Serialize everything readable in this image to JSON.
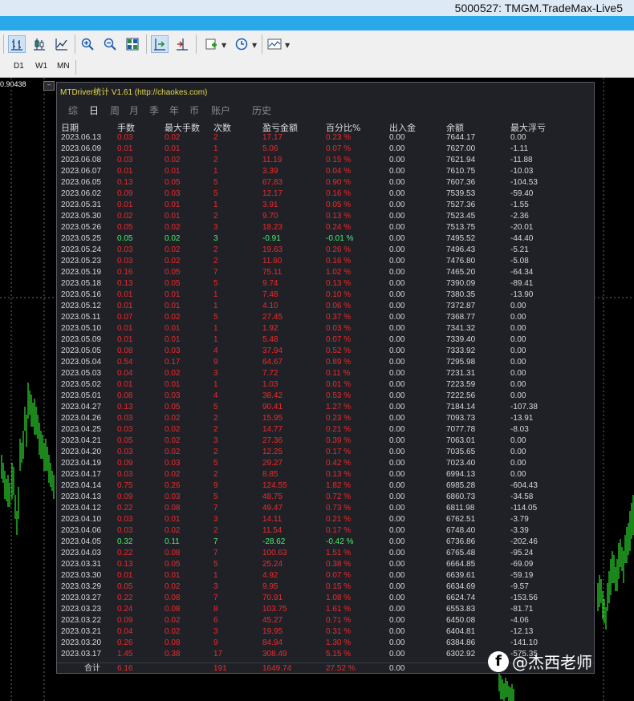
{
  "window": {
    "title": "5000527: TMGM.TradeMax-Live5"
  },
  "toolbar": {
    "icons": [
      "bar-chart-icon",
      "candlestick-icon",
      "line-chart-icon",
      "zoom-in-icon",
      "zoom-out-icon",
      "tile-windows-icon",
      "chart-shift-icon",
      "autoscroll-icon",
      "indicators-icon",
      "periods-icon",
      "templates-icon"
    ]
  },
  "timeframes": [
    "D1",
    "W1",
    "MN"
  ],
  "chart": {
    "price_label": "0.90438"
  },
  "panel": {
    "title": "MTDriver统计 V1.61  (http://chaokes.com)",
    "minimize_label": "–",
    "tabs": [
      "综",
      "日",
      "周",
      "月",
      "季",
      "年",
      "币",
      "账户",
      "历史"
    ],
    "active_tab": "日",
    "headers": [
      "日期",
      "手数",
      "最大手数",
      "次数",
      "盈亏金额",
      "百分比%",
      "出入金",
      "余额",
      "最大浮亏"
    ],
    "rows": [
      [
        "2023.06.13",
        "0.03",
        "0.02",
        "2",
        "17.17",
        "0.23 %",
        "0.00",
        "7644.17",
        "0.00"
      ],
      [
        "2023.06.09",
        "0.01",
        "0.01",
        "1",
        "5.06",
        "0.07 %",
        "0.00",
        "7627.00",
        "-1.11"
      ],
      [
        "2023.06.08",
        "0.03",
        "0.02",
        "2",
        "11.19",
        "0.15 %",
        "0.00",
        "7621.94",
        "-11.88"
      ],
      [
        "2023.06.07",
        "0.01",
        "0.01",
        "1",
        "3.39",
        "0.04 %",
        "0.00",
        "7610.75",
        "-10.03"
      ],
      [
        "2023.06.05",
        "0.13",
        "0.05",
        "5",
        "67.83",
        "0.90 %",
        "0.00",
        "7607.36",
        "-104.53"
      ],
      [
        "2023.06.02",
        "0.09",
        "0.03",
        "5",
        "12.17",
        "0.16 %",
        "0.00",
        "7539.53",
        "-59.40"
      ],
      [
        "2023.05.31",
        "0.01",
        "0.01",
        "1",
        "3.91",
        "0.05 %",
        "0.00",
        "7527.36",
        "-1.55"
      ],
      [
        "2023.05.30",
        "0.02",
        "0.01",
        "2",
        "9.70",
        "0.13 %",
        "0.00",
        "7523.45",
        "-2.36"
      ],
      [
        "2023.05.26",
        "0.05",
        "0.02",
        "3",
        "18.23",
        "0.24 %",
        "0.00",
        "7513.75",
        "-20.01"
      ],
      [
        "2023.05.25",
        "0.05",
        "0.02",
        "3",
        "-0.91",
        "-0.01 %",
        "0.00",
        "7495.52",
        "-44.40"
      ],
      [
        "2023.05.24",
        "0.03",
        "0.02",
        "2",
        "19.63",
        "0.26 %",
        "0.00",
        "7496.43",
        "-5.21"
      ],
      [
        "2023.05.23",
        "0.03",
        "0.02",
        "2",
        "11.60",
        "0.16 %",
        "0.00",
        "7476.80",
        "-5.08"
      ],
      [
        "2023.05.19",
        "0.16",
        "0.05",
        "7",
        "75.11",
        "1.02 %",
        "0.00",
        "7465.20",
        "-64.34"
      ],
      [
        "2023.05.18",
        "0.13",
        "0.05",
        "5",
        "9.74",
        "0.13 %",
        "0.00",
        "7390.09",
        "-89.41"
      ],
      [
        "2023.05.16",
        "0.01",
        "0.01",
        "1",
        "7.48",
        "0.10 %",
        "0.00",
        "7380.35",
        "-13.90"
      ],
      [
        "2023.05.12",
        "0.01",
        "0.01",
        "1",
        "4.10",
        "0.06 %",
        "0.00",
        "7372.87",
        "0.00"
      ],
      [
        "2023.05.11",
        "0.07",
        "0.02",
        "5",
        "27.45",
        "0.37 %",
        "0.00",
        "7368.77",
        "0.00"
      ],
      [
        "2023.05.10",
        "0.01",
        "0.01",
        "1",
        "1.92",
        "0.03 %",
        "0.00",
        "7341.32",
        "0.00"
      ],
      [
        "2023.05.09",
        "0.01",
        "0.01",
        "1",
        "5.48",
        "0.07 %",
        "0.00",
        "7339.40",
        "0.00"
      ],
      [
        "2023.05.05",
        "0.08",
        "0.03",
        "4",
        "37.94",
        "0.52 %",
        "0.00",
        "7333.92",
        "0.00"
      ],
      [
        "2023.05.04",
        "0.54",
        "0.17",
        "9",
        "64.67",
        "0.89 %",
        "0.00",
        "7295.98",
        "0.00"
      ],
      [
        "2023.05.03",
        "0.04",
        "0.02",
        "3",
        "7.72",
        "0.11 %",
        "0.00",
        "7231.31",
        "0.00"
      ],
      [
        "2023.05.02",
        "0.01",
        "0.01",
        "1",
        "1.03",
        "0.01 %",
        "0.00",
        "7223.59",
        "0.00"
      ],
      [
        "2023.05.01",
        "0.08",
        "0.03",
        "4",
        "38.42",
        "0.53 %",
        "0.00",
        "7222.56",
        "0.00"
      ],
      [
        "2023.04.27",
        "0.13",
        "0.05",
        "5",
        "90.41",
        "1.27 %",
        "0.00",
        "7184.14",
        "-107.38"
      ],
      [
        "2023.04.26",
        "0.03",
        "0.02",
        "2",
        "15.95",
        "0.23 %",
        "0.00",
        "7093.73",
        "-13.91"
      ],
      [
        "2023.04.25",
        "0.03",
        "0.02",
        "2",
        "14.77",
        "0.21 %",
        "0.00",
        "7077.78",
        "-8.03"
      ],
      [
        "2023.04.21",
        "0.05",
        "0.02",
        "3",
        "27.36",
        "0.39 %",
        "0.00",
        "7063.01",
        "0.00"
      ],
      [
        "2023.04.20",
        "0.03",
        "0.02",
        "2",
        "12.25",
        "0.17 %",
        "0.00",
        "7035.65",
        "0.00"
      ],
      [
        "2023.04.19",
        "0.09",
        "0.03",
        "5",
        "29.27",
        "0.42 %",
        "0.00",
        "7023.40",
        "0.00"
      ],
      [
        "2023.04.17",
        "0.03",
        "0.02",
        "2",
        "8.85",
        "0.13 %",
        "0.00",
        "6994.13",
        "0.00"
      ],
      [
        "2023.04.14",
        "0.75",
        "0.26",
        "9",
        "124.55",
        "1.82 %",
        "0.00",
        "6985.28",
        "-604.43"
      ],
      [
        "2023.04.13",
        "0.09",
        "0.03",
        "5",
        "48.75",
        "0.72 %",
        "0.00",
        "6860.73",
        "-34.58"
      ],
      [
        "2023.04.12",
        "0.22",
        "0.08",
        "7",
        "49.47",
        "0.73 %",
        "0.00",
        "6811.98",
        "-114.05"
      ],
      [
        "2023.04.10",
        "0.03",
        "0.01",
        "3",
        "14.11",
        "0.21 %",
        "0.00",
        "6762.51",
        "-3.79"
      ],
      [
        "2023.04.06",
        "0.03",
        "0.02",
        "2",
        "11.54",
        "0.17 %",
        "0.00",
        "6748.40",
        "-3.39"
      ],
      [
        "2023.04.05",
        "0.32",
        "0.11",
        "7",
        "-28.62",
        "-0.42 %",
        "0.00",
        "6736.86",
        "-202.46"
      ],
      [
        "2023.04.03",
        "0.22",
        "0.08",
        "7",
        "100.63",
        "1.51 %",
        "0.00",
        "6765.48",
        "-95.24"
      ],
      [
        "2023.03.31",
        "0.13",
        "0.05",
        "5",
        "25.24",
        "0.38 %",
        "0.00",
        "6664.85",
        "-69.09"
      ],
      [
        "2023.03.30",
        "0.01",
        "0.01",
        "1",
        "4.92",
        "0.07 %",
        "0.00",
        "6639.61",
        "-59.19"
      ],
      [
        "2023.03.29",
        "0.05",
        "0.02",
        "3",
        "9.95",
        "0.15 %",
        "0.00",
        "6634.69",
        "-9.57"
      ],
      [
        "2023.03.27",
        "0.22",
        "0.08",
        "7",
        "70.91",
        "1.08 %",
        "0.00",
        "6624.74",
        "-153.56"
      ],
      [
        "2023.03.23",
        "0.24",
        "0.08",
        "8",
        "103.75",
        "1.61 %",
        "0.00",
        "6553.83",
        "-81.71"
      ],
      [
        "2023.03.22",
        "0.09",
        "0.02",
        "6",
        "45.27",
        "0.71 %",
        "0.00",
        "6450.08",
        "-4.06"
      ],
      [
        "2023.03.21",
        "0.04",
        "0.02",
        "3",
        "19.95",
        "0.31 %",
        "0.00",
        "6404.81",
        "-12.13"
      ],
      [
        "2023.03.20",
        "0.26",
        "0.08",
        "9",
        "84.94",
        "1.30 %",
        "0.00",
        "6384.86",
        "-141.10"
      ],
      [
        "2023.03.17",
        "1.45",
        "0.38",
        "17",
        "308.49",
        "5.15 %",
        "0.00",
        "6302.92",
        "-575.35"
      ]
    ],
    "total": {
      "label": "合计",
      "lots": "6.16",
      "count": "191",
      "pl": "1649.74",
      "pct": "27.52 %",
      "flow": "0.00"
    }
  },
  "watermark": {
    "text": "@杰西老师",
    "logo": "f"
  }
}
